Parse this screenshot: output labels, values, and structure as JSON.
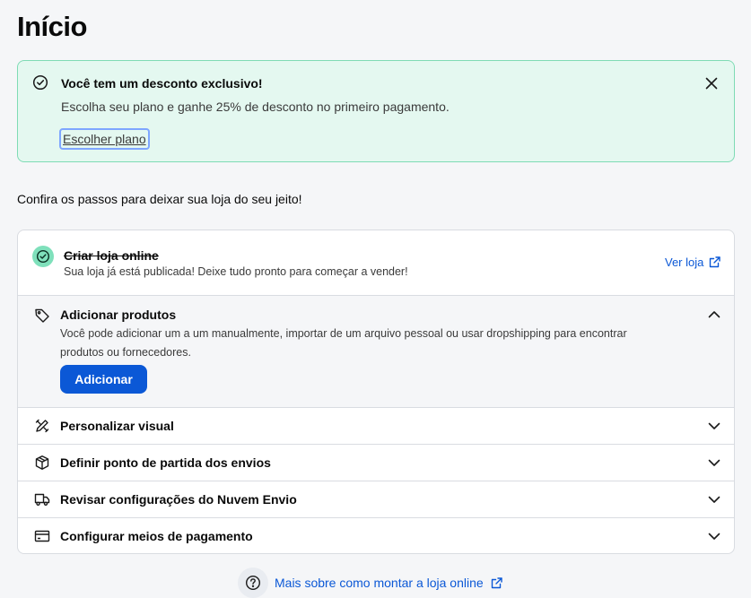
{
  "page": {
    "title": "Início"
  },
  "banner": {
    "title": "Você tem um desconto exclusivo!",
    "text": "Escolha seu plano e ganhe 25% de desconto no primeiro pagamento.",
    "link": "Escolher plano",
    "icon": "check-circle-icon",
    "bg": "#e4f8f0",
    "border": "#7fdbb5"
  },
  "intro": "Confira os passos para deixar sua loja do seu jeito!",
  "steps": [
    {
      "title": "Criar loja online",
      "description": "Sua loja já está publicada! Deixe tudo pronto para começar a vender!",
      "status": "completed",
      "action": "Ver loja",
      "icon": "check-circle-icon"
    },
    {
      "title": "Adicionar produtos",
      "description": "Você pode adicionar um a um manualmente, importar de um arquivo pessoal ou usar dropshipping para encontrar produtos ou fornecedores.",
      "button": "Adicionar",
      "expanded": true,
      "icon": "tag-icon"
    },
    {
      "title": "Personalizar visual",
      "expanded": false,
      "icon": "design-tools-icon"
    },
    {
      "title": "Definir ponto de partida dos envios",
      "expanded": false,
      "icon": "box-icon"
    },
    {
      "title": "Revisar configurações do Nuvem Envio",
      "expanded": false,
      "icon": "truck-icon"
    },
    {
      "title": "Configurar meios de pagamento",
      "expanded": false,
      "icon": "credit-card-icon"
    }
  ],
  "help": {
    "text": "Mais sobre como montar a loja online",
    "icon": "help-circle-icon"
  },
  "colors": {
    "primary": "#0b58d6",
    "success": "#7fe0bb",
    "background": "#f5f6f8"
  }
}
